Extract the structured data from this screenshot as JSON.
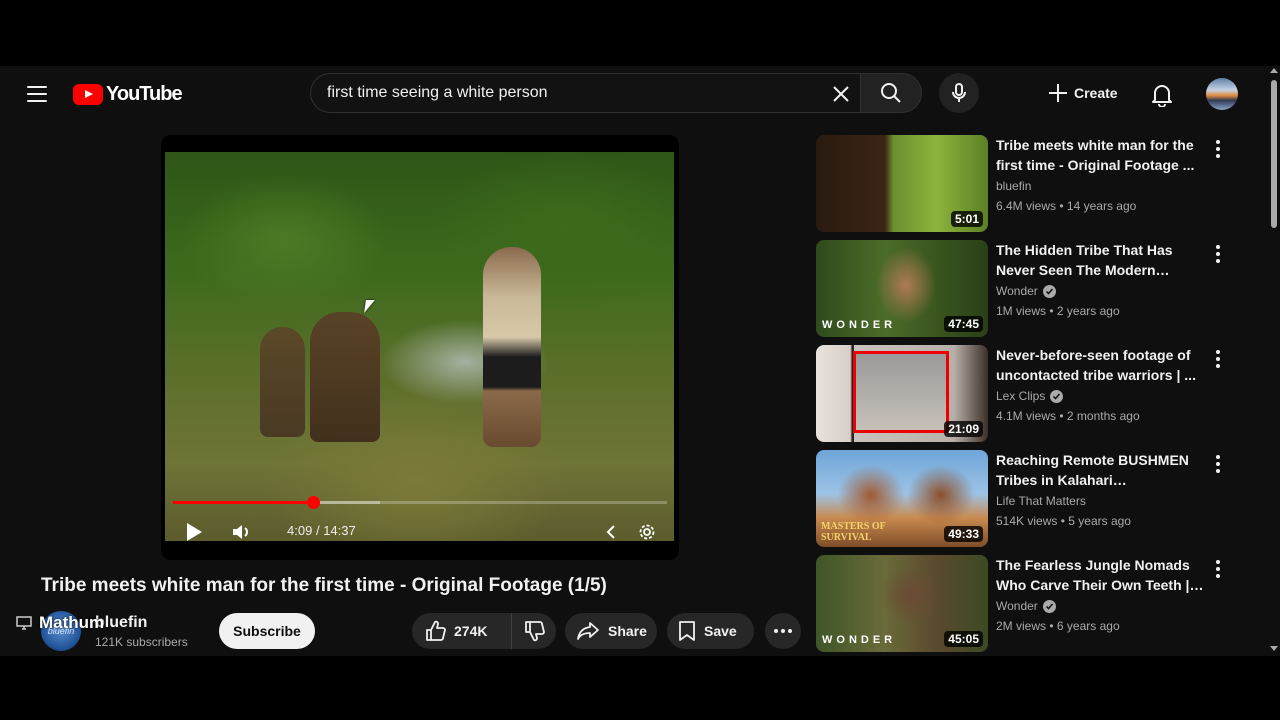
{
  "header": {
    "logo_text": "YouTube",
    "search_value": "first time seeing a white person",
    "create_label": "Create"
  },
  "player": {
    "time_current": "4:09",
    "time_separator": "/",
    "time_total": "14:37",
    "progress_fraction": 0.284,
    "buffer_fraction": 0.42
  },
  "video": {
    "title": "Tribe meets white man for the first time - Original Footage (1/5)",
    "overlay_text": "Mathum",
    "channel_name": "bluefin",
    "channel_avatar_text": "bluefin",
    "subscribers": "121K subscribers",
    "subscribe_label": "Subscribe",
    "likes": "274K",
    "share_label": "Share",
    "save_label": "Save"
  },
  "recommendations": [
    {
      "title": "Tribe meets white man for the first time - Original Footage ...",
      "channel": "bluefin",
      "verified": false,
      "views": "6.4M views",
      "age": "14 years ago",
      "duration": "5:01",
      "watermark": ""
    },
    {
      "title": "The Hidden Tribe That Has Never Seen The Modern World...",
      "channel": "Wonder",
      "verified": true,
      "views": "1M views",
      "age": "2 years ago",
      "duration": "47:45",
      "watermark": "WONDER"
    },
    {
      "title": "Never-before-seen footage of uncontacted tribe warriors | ...",
      "channel": "Lex Clips",
      "verified": true,
      "views": "4.1M views",
      "age": "2 months ago",
      "duration": "21:09",
      "watermark": ""
    },
    {
      "title": "Reaching Remote BUSHMEN Tribes in Kalahari Documentar...",
      "channel": "Life That Matters",
      "verified": false,
      "views": "514K views",
      "age": "5 years ago",
      "duration": "49:33",
      "watermark": "MASTERS OF SURVIVAL"
    },
    {
      "title": "The Fearless Jungle Nomads Who Carve Their Own Teeth | ...",
      "channel": "Wonder",
      "verified": true,
      "views": "2M views",
      "age": "6 years ago",
      "duration": "45:05",
      "watermark": "WONDER"
    }
  ],
  "meta_separator": "•",
  "colors": {
    "background": "#0f0f0f",
    "brand_red": "#ff0000",
    "pill": "#272727",
    "secondary_text": "#aaaaaa"
  }
}
